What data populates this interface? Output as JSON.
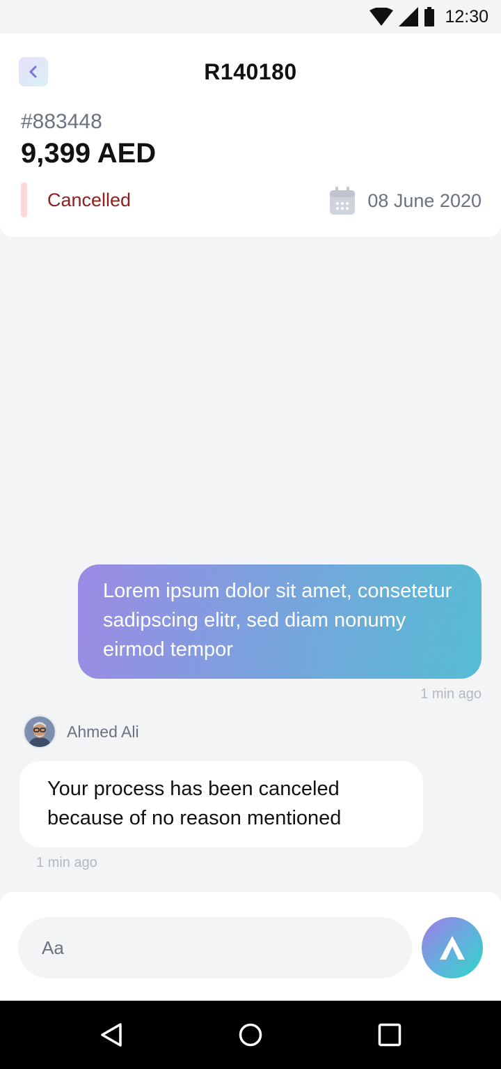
{
  "status_bar": {
    "time": "12:30"
  },
  "header": {
    "title": "R140180",
    "order_number": "#883448",
    "amount": "9,399 AED",
    "status": "Cancelled",
    "date": "08 June 2020"
  },
  "chat": {
    "outgoing": {
      "text": "Lorem ipsum dolor sit amet, consetetur sadipscing elitr, sed diam nonumy eirmod tempor",
      "time": "1 min ago"
    },
    "incoming": {
      "sender": "Ahmed Ali",
      "text": "Your process has been canceled because of no reason mentioned",
      "time": "1 min ago"
    }
  },
  "composer": {
    "placeholder": "Aa"
  },
  "icons": {
    "back": "chevron-left-icon",
    "calendar": "calendar-icon",
    "send": "send-icon",
    "nav_back": "triangle-back-icon",
    "nav_home": "circle-home-icon",
    "nav_recents": "square-recents-icon"
  },
  "colors": {
    "status_cancelled": "#8b1f1f",
    "status_accent": "#fdd8d8",
    "bubble_gradient_start": "#9b8ae4",
    "bubble_gradient_end": "#56bcd3"
  }
}
